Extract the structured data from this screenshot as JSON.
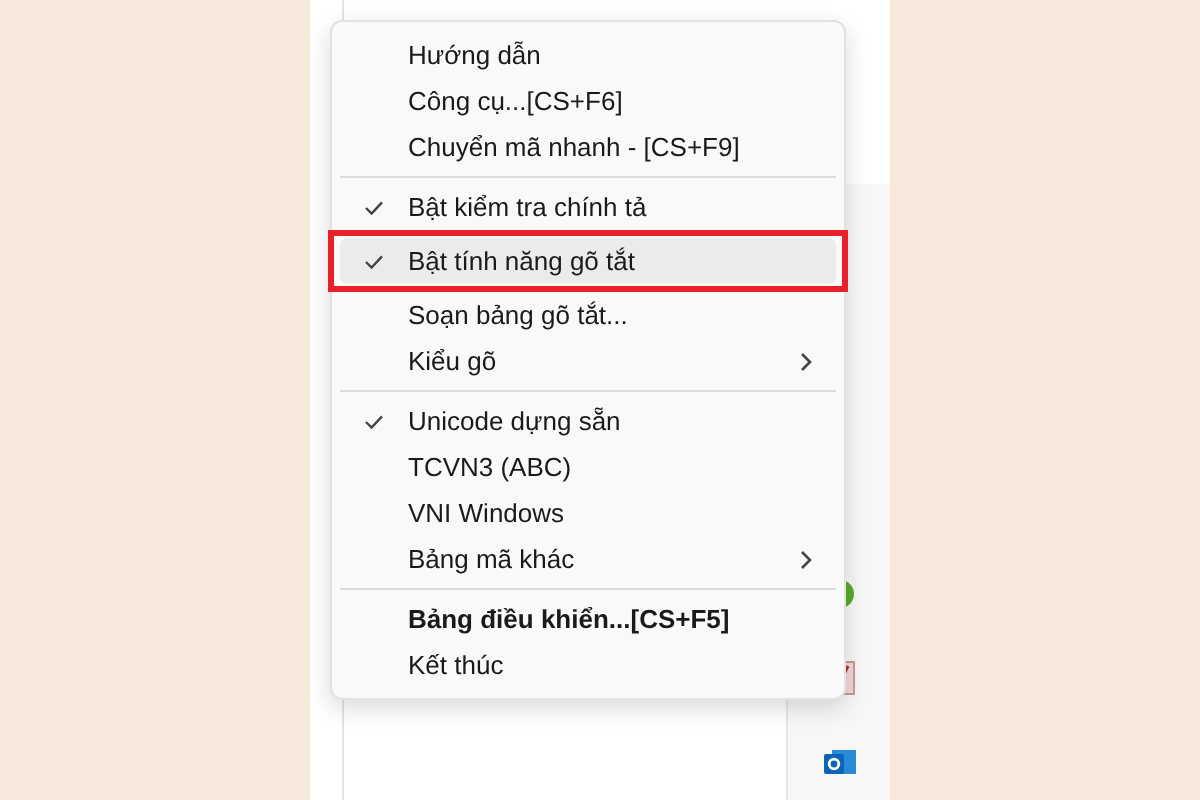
{
  "menu": {
    "groups": [
      {
        "items": [
          {
            "label": "Hướng dẫn",
            "checked": false,
            "selected": false,
            "submenu": false,
            "bold": false,
            "marked": false
          },
          {
            "label": "Công cụ...[CS+F6]",
            "checked": false,
            "selected": false,
            "submenu": false,
            "bold": false,
            "marked": false
          },
          {
            "label": "Chuyển mã nhanh - [CS+F9]",
            "checked": false,
            "selected": false,
            "submenu": false,
            "bold": false,
            "marked": false
          }
        ]
      },
      {
        "items": [
          {
            "label": "Bật kiểm tra chính tả",
            "checked": true,
            "selected": false,
            "submenu": false,
            "bold": false,
            "marked": false
          },
          {
            "label": "Bật tính năng gõ tắt",
            "checked": true,
            "selected": true,
            "submenu": false,
            "bold": false,
            "marked": true
          },
          {
            "label": "Soạn bảng gõ tắt...",
            "checked": false,
            "selected": false,
            "submenu": false,
            "bold": false,
            "marked": false
          },
          {
            "label": "Kiểu gõ",
            "checked": false,
            "selected": false,
            "submenu": true,
            "bold": false,
            "marked": false
          }
        ]
      },
      {
        "items": [
          {
            "label": "Unicode dựng sẵn",
            "checked": true,
            "selected": false,
            "submenu": false,
            "bold": false,
            "marked": false
          },
          {
            "label": "TCVN3 (ABC)",
            "checked": false,
            "selected": false,
            "submenu": false,
            "bold": false,
            "marked": false
          },
          {
            "label": "VNI Windows",
            "checked": false,
            "selected": false,
            "submenu": false,
            "bold": false,
            "marked": false
          },
          {
            "label": "Bảng mã khác",
            "checked": false,
            "selected": false,
            "submenu": true,
            "bold": false,
            "marked": false
          }
        ]
      },
      {
        "items": [
          {
            "label": "Bảng điều khiển...[CS+F5]",
            "checked": false,
            "selected": false,
            "submenu": false,
            "bold": true,
            "marked": false
          },
          {
            "label": "Kết thúc",
            "checked": false,
            "selected": false,
            "submenu": false,
            "bold": false,
            "marked": false
          }
        ]
      }
    ]
  }
}
